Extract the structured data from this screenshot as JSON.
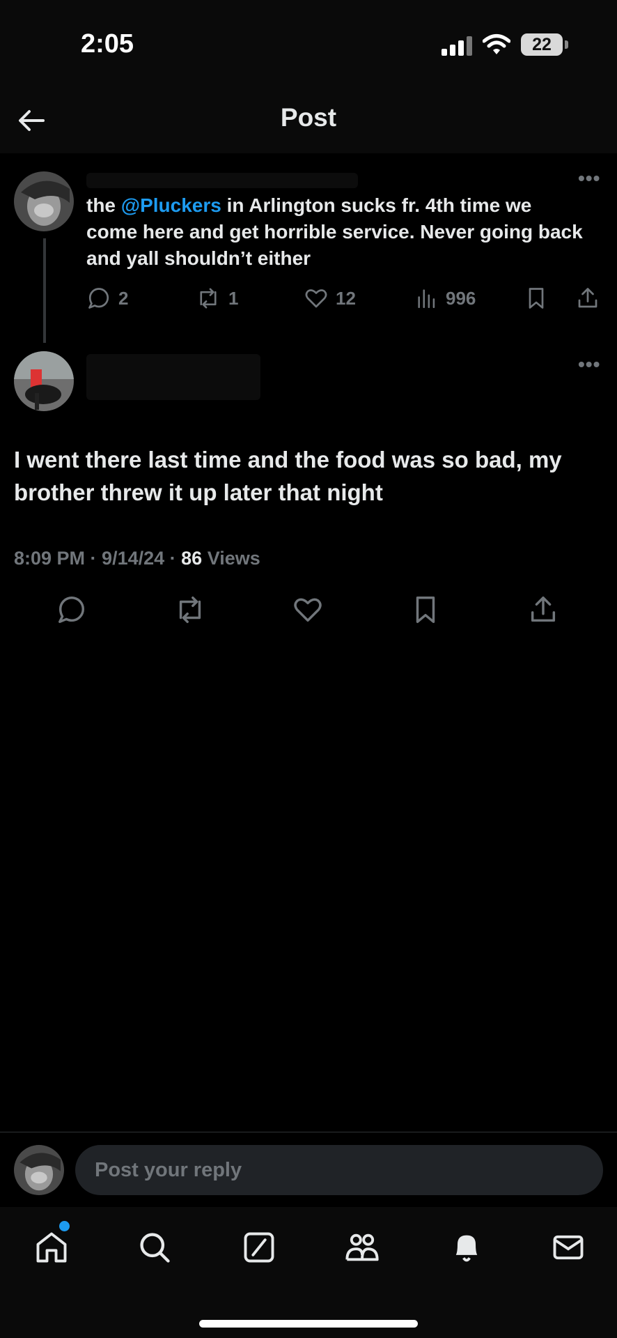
{
  "status": {
    "time": "2:05",
    "battery": "22"
  },
  "nav": {
    "title": "Post"
  },
  "original_post": {
    "text_before": "the ",
    "mention": "@Pluckers",
    "text_after": " in Arlington sucks fr. 4th time we come here and get horrible service. Never going back and yall shouldn’t either",
    "replies": "2",
    "reposts": "1",
    "likes": "12",
    "views": "996"
  },
  "reply_post": {
    "text": "I went there last time and the food was so bad, my brother threw it up later that night",
    "time": "8:09 PM",
    "date": "9/14/24",
    "views_count": "86",
    "views_label": "Views"
  },
  "reply_bar": {
    "placeholder": "Post your reply"
  },
  "colors": {
    "accent": "#1d9bf0",
    "muted": "#71767b",
    "text": "#e7e9ea",
    "background": "#000000"
  }
}
